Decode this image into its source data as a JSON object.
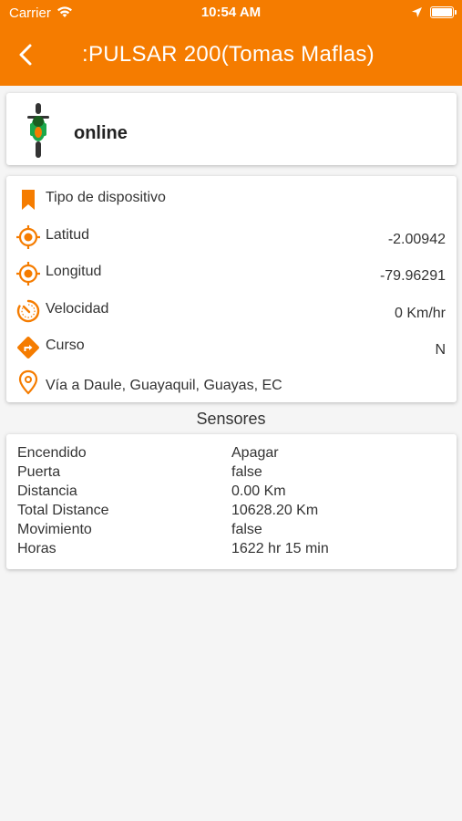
{
  "status_bar": {
    "carrier": "Carrier",
    "time": "10:54 AM"
  },
  "header": {
    "title": ":PULSAR 200(Tomas Maflas)",
    "back_icon": "chevron-left-icon",
    "background_color": "#f57c00"
  },
  "device": {
    "icon": "motorcycle-icon",
    "status": "online"
  },
  "info": {
    "rows": [
      {
        "icon": "bookmark-icon",
        "label": "Tipo de dispositivo",
        "value": ""
      },
      {
        "icon": "crosshair-icon",
        "label": "Latitud",
        "value": "-2.00942"
      },
      {
        "icon": "crosshair-icon",
        "label": "Longitud",
        "value": "-79.96291"
      },
      {
        "icon": "speedometer-icon",
        "label": "Velocidad",
        "value": "0 Km/hr"
      },
      {
        "icon": "direction-icon",
        "label": "Curso",
        "value": "N"
      },
      {
        "icon": "map-pin-icon",
        "label": "Vía a Daule, Guayaquil, Guayas, EC",
        "value": ""
      }
    ]
  },
  "sensors": {
    "title": "Sensores",
    "rows": [
      {
        "label": "Encendido",
        "value": "Apagar"
      },
      {
        "label": "Puerta",
        "value": "false"
      },
      {
        "label": "Distancia",
        "value": "0.00 Km"
      },
      {
        "label": "Total Distance",
        "value": "10628.20 Km"
      },
      {
        "label": "Movimiento",
        "value": "false"
      },
      {
        "label": "Horas",
        "value": "1622 hr 15 min"
      }
    ]
  },
  "colors": {
    "accent": "#f57c00",
    "icon": "#f57c00",
    "background": "#f5f5f5"
  }
}
